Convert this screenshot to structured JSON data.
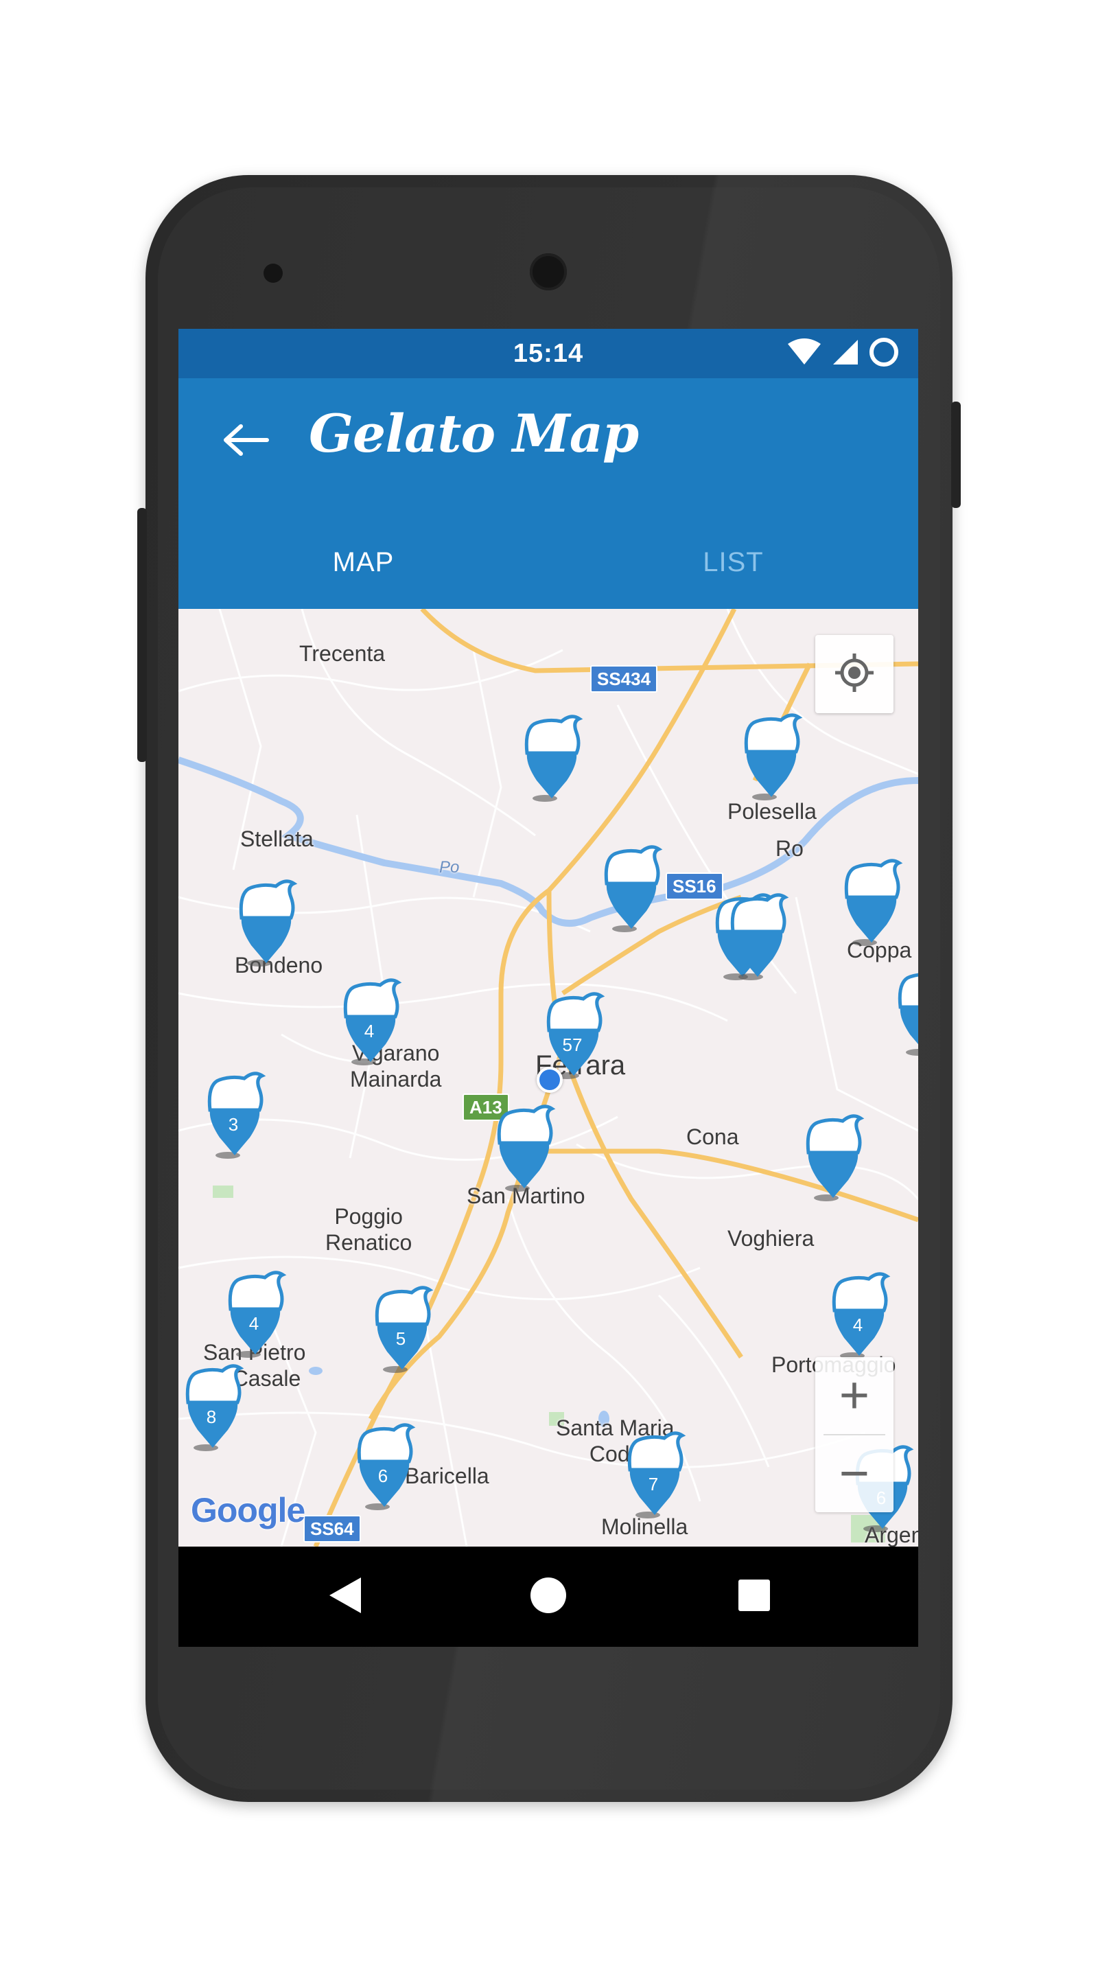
{
  "status_bar": {
    "time": "15:14",
    "icons": [
      "wifi-icon",
      "signal-icon",
      "battery-icon"
    ]
  },
  "app_bar": {
    "title": "Gelato Map",
    "back_icon": "arrow-left-icon",
    "color": "#1d7cc0"
  },
  "tabs": [
    {
      "label": "MAP",
      "active": true
    },
    {
      "label": "LIST",
      "active": false
    }
  ],
  "map": {
    "places": {
      "trecenta": "Trecenta",
      "polesella": "Polesella",
      "ro": "Ro",
      "stellata": "Stellata",
      "po": "Po",
      "bondeno": "Bondeno",
      "coppa": "Coppa",
      "vigarano": "Vigarano\nMainarda",
      "ferrara": "Ferrara",
      "cona": "Cona",
      "san_martino": "San Martino",
      "poggio": "Poggio\nRenatico",
      "voghiera": "Voghiera",
      "san_pietro": "San Pietro\nIn Casale",
      "portomaggiore": "Portomaggio",
      "santa_maria": "Santa Maria\nCodif",
      "baricella": "Baricella",
      "molinella": "Molinella",
      "argenta": "Argen"
    },
    "road_shields": {
      "ss434": "SS434",
      "ss16": "SS16",
      "a13": "A13",
      "ss64": "SS64"
    },
    "pin_counts": {
      "vigarano": "4",
      "ferrara": "57",
      "west": "3",
      "san_pietro": "4",
      "poggio_south": "5",
      "portomaggiore": "4",
      "southwest": "8",
      "baricella": "6",
      "molinella": "7",
      "argenta": "6"
    },
    "attribution": "Google",
    "pin_color": "#2e8dd0"
  },
  "controls": {
    "locate_icon": "my-location-icon",
    "zoom_in": "+",
    "zoom_out": "−"
  },
  "nav_bar": {
    "back_icon": "nav-back-icon",
    "home_icon": "nav-home-icon",
    "recents_icon": "nav-recents-icon"
  }
}
